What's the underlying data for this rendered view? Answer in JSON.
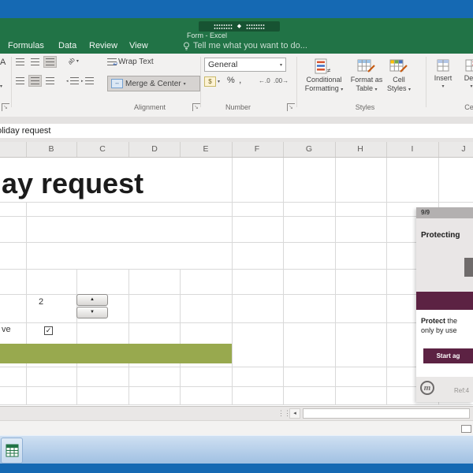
{
  "colors": {
    "excel_green": "#217346",
    "desktop_blue": "#1569b3",
    "taskbar_blue": "#a0c0e2",
    "form_accent_olive": "#98a94e",
    "panel_maroon": "#5c2243",
    "panel_gray": "#e9e6e6",
    "panel_header_gray": "#b3b0b0"
  },
  "window": {
    "title": "Form - Excel"
  },
  "tabs": [
    "Formulas",
    "Data",
    "Review",
    "View"
  ],
  "tell_me": "Tell me what you want to do...",
  "ribbon": {
    "font_fragment": "A",
    "alignment": {
      "orientation_glyph": "ab",
      "wrap_text": "Wrap Text",
      "merge_center": "Merge & Center",
      "group_label": "Alignment"
    },
    "number": {
      "format_value": "General",
      "currency_glyph": "$",
      "percent": "%",
      "comma": ",",
      "increase_decimal_glyph": "←.0",
      "decrease_decimal_glyph": ".00→",
      "group_label": "Number"
    },
    "styles": {
      "conditional_line1": "Conditional",
      "conditional_line2": "Formatting",
      "format_table_line1": "Format as",
      "format_table_line2": "Table",
      "cell_styles_line1": "Cell",
      "cell_styles_line2": "Styles",
      "group_label": "Styles"
    },
    "cells": {
      "insert": "Insert",
      "delete_partial": "Dele",
      "group_label": "Ce"
    }
  },
  "formula_bar": {
    "value": "oliday request"
  },
  "sheet": {
    "column_headers": [
      "B",
      "C",
      "D",
      "E",
      "F",
      "G",
      "H",
      "I",
      "J"
    ],
    "title_text": "ay request",
    "days_value": "2",
    "checkbox_label_fragment": "ve",
    "checkbox_checked": true
  },
  "panel": {
    "step": "9/9",
    "heading": "Protecting",
    "body_bold": "Protect",
    "body_after_bold": " the",
    "body_line2": "only by use",
    "start_button": "Start ag",
    "logo_letter": "m",
    "ref": "Ref:4"
  },
  "glyphs": {
    "caret": "▾",
    "up": "▲",
    "down": "▼",
    "left_scroll": "◂",
    "check": "✓",
    "diamond": "◆",
    "wrap_return": "↵",
    "merge_arrows": "↔",
    "launcher_arrow": "↘",
    "grip": "⋮⋮"
  }
}
